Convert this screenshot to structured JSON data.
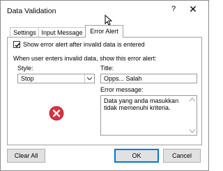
{
  "window": {
    "title": "Data Validation",
    "help_glyph": "?",
    "close_glyph": "✕"
  },
  "tabs": [
    {
      "label": "Settings"
    },
    {
      "label": "Input Message"
    },
    {
      "label": "Error Alert",
      "active": true
    }
  ],
  "error_alert": {
    "show_alert": {
      "label": "Show error alert after invalid data is entered",
      "checked": true
    },
    "description": "When user enters invalid data, show this error alert:",
    "style": {
      "label": "Style:",
      "value": "Stop"
    },
    "title": {
      "label": "Title:",
      "value": "Opps... Salah"
    },
    "message": {
      "label": "Error message:",
      "value": "Data yang anda masukkan tidak memenuhi kriteria."
    },
    "icon": "stop-error-icon"
  },
  "buttons": {
    "clear_all": "Clear All",
    "ok": "OK",
    "cancel": "Cancel"
  },
  "colors": {
    "accent": "#0078d7",
    "error_red": "#d9333f"
  }
}
